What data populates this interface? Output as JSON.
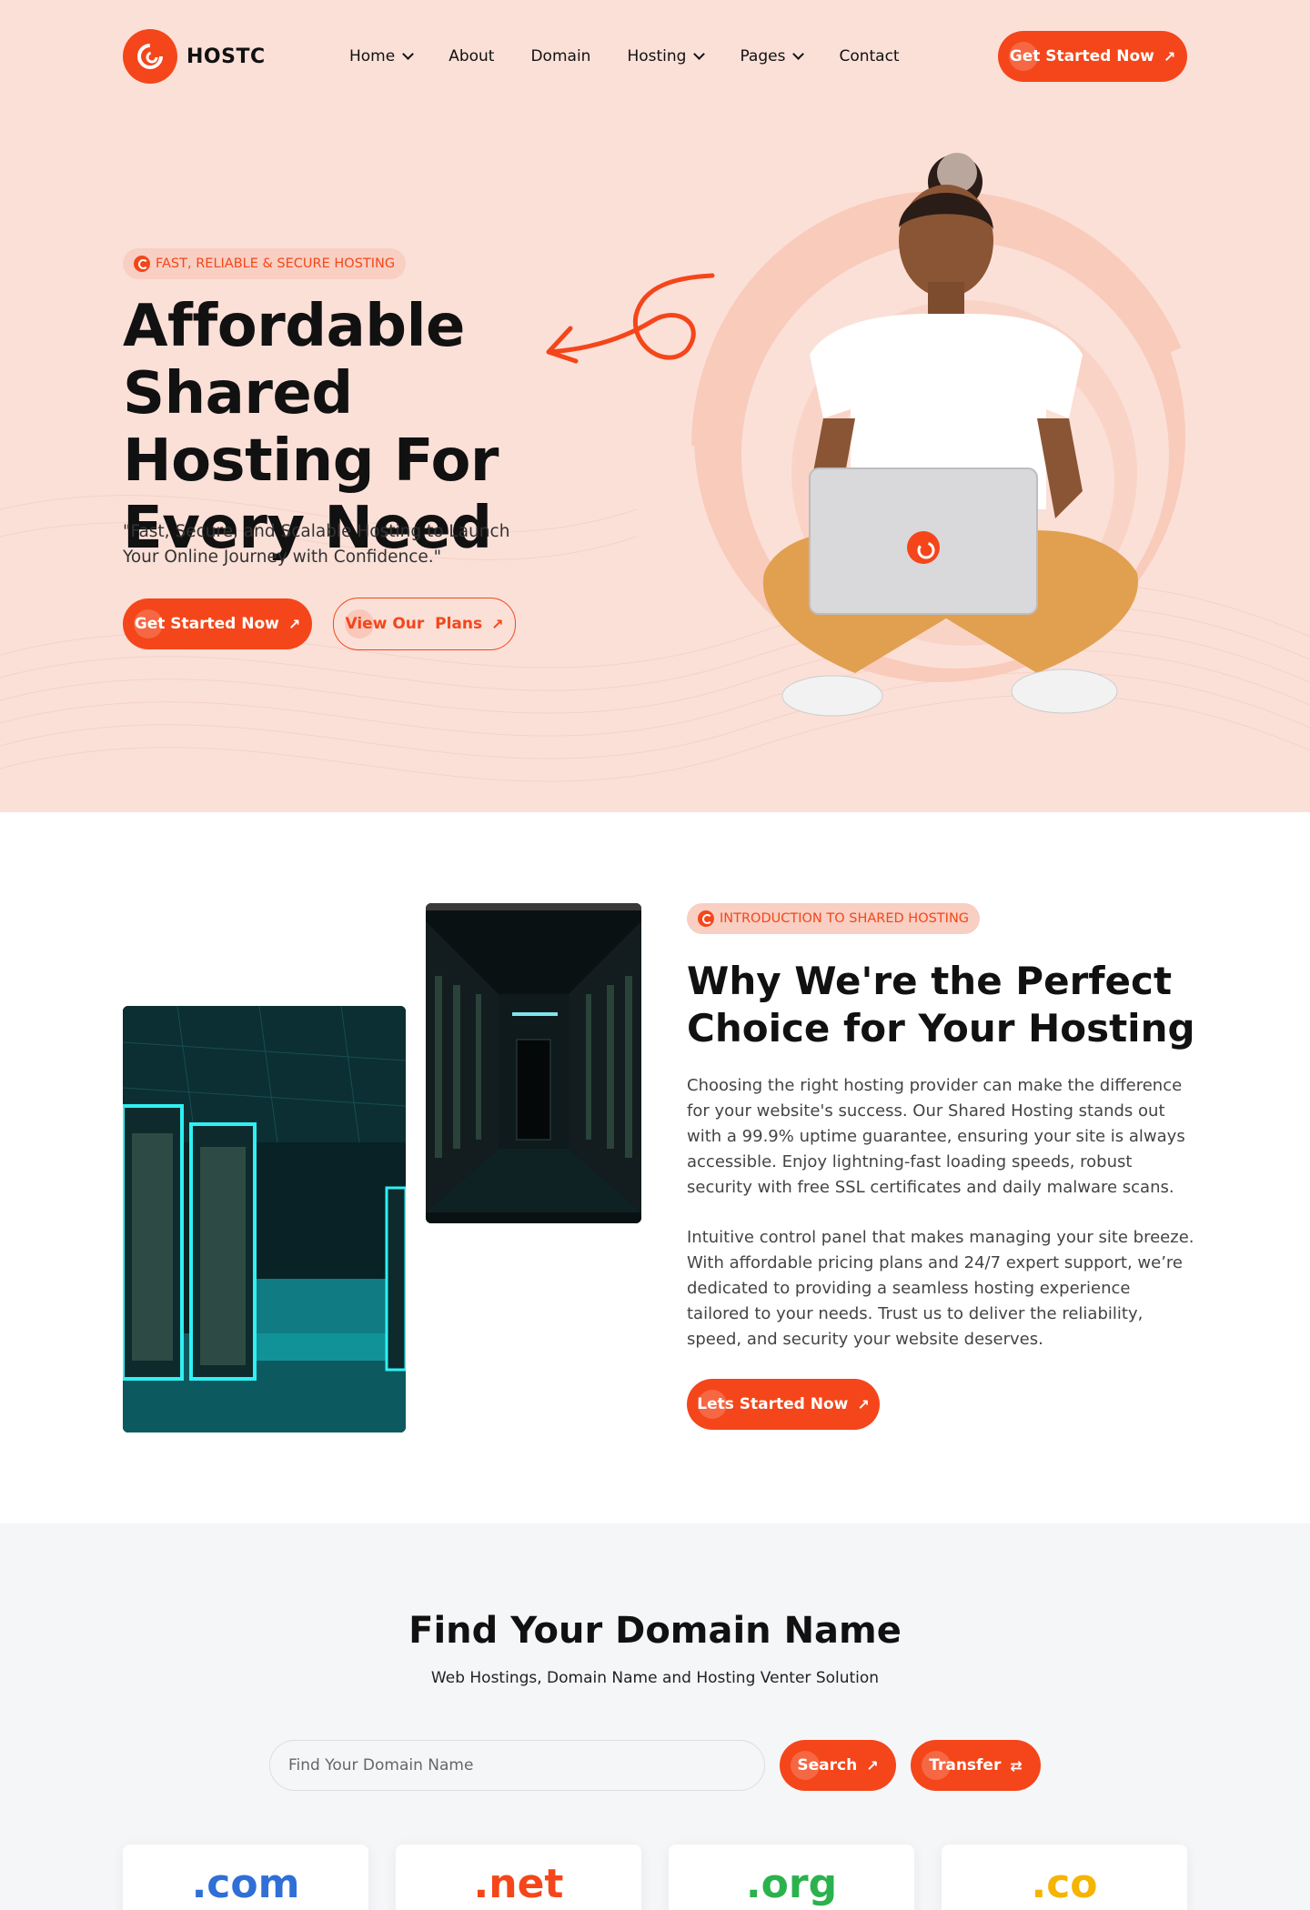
{
  "brand": {
    "name": "HOSTC",
    "accent": "#f4461a",
    "hero_bg": "#fbe0d8"
  },
  "nav": {
    "items": [
      {
        "label": "Home",
        "has_dropdown": true
      },
      {
        "label": "About",
        "has_dropdown": false
      },
      {
        "label": "Domain",
        "has_dropdown": false
      },
      {
        "label": "Hosting",
        "has_dropdown": true
      },
      {
        "label": "Pages",
        "has_dropdown": true
      },
      {
        "label": "Contact",
        "has_dropdown": false
      }
    ],
    "cta_label": "Get Started Now"
  },
  "hero": {
    "tag": "FAST, RELIABLE & SECURE HOSTING",
    "title": "Affordable Shared Hosting For Every Need",
    "subtitle": "\"Fast, Secure, and Scalable Hosting to Launch Your Online Journey with Confidence.\"",
    "primary_button": "Get Started Now",
    "secondary_button": "View Our  Plans"
  },
  "about": {
    "tag": "INTRODUCTION TO SHARED HOSTING",
    "title": "Why We're the Perfect Choice for Your Hosting",
    "paragraph1": "Choosing the right hosting provider can make  the difference for your website's success. Our Shared Hosting stands out with a 99.9% uptime guarantee, ensuring your site is always accessible. Enjoy lightning-fast loading speeds, robust security with free SSL certificates and daily malware scans.",
    "paragraph2": "Intuitive control panel that makes managing your site breeze. With affordable pricing plans and 24/7 expert support, we’re dedicated to providing a seamless hosting experience tailored to your needs. Trust us to deliver the reliability, speed, and security your website deserves.",
    "button": "Lets Started Now"
  },
  "domain": {
    "title": "Find Your Domain Name",
    "subtitle": "Web Hostings, Domain Name and Hosting Venter Solution",
    "search_placeholder": "Find Your Domain Name",
    "search_button": "Search",
    "transfer_button": "Transfer",
    "tlds": [
      {
        "label": ".com",
        "color": "#2f6fd6"
      },
      {
        "label": ".net",
        "color": "#f4461a"
      },
      {
        "label": ".org",
        "color": "#2bb24c"
      },
      {
        "label": ".co",
        "color": "#f5b400"
      }
    ]
  }
}
